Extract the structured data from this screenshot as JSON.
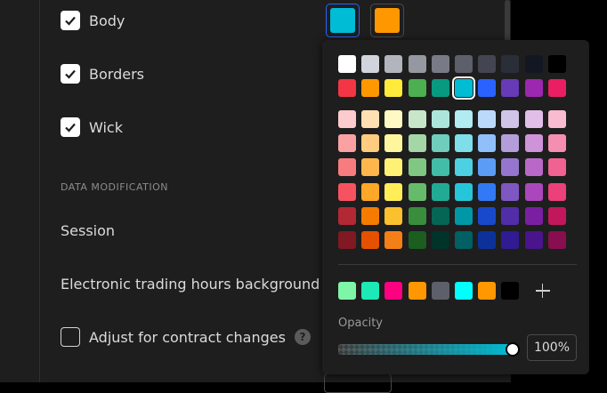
{
  "options": {
    "body": {
      "label": "Body",
      "checked": true
    },
    "borders": {
      "label": "Borders",
      "checked": true
    },
    "wick": {
      "label": "Wick",
      "checked": true
    }
  },
  "section_title": "DATA MODIFICATION",
  "session_label": "Session",
  "eth_label": "Electronic trading hours background",
  "adjust": {
    "label": "Adjust for contract changes",
    "checked": false,
    "help_icon": "?"
  },
  "body_colors": {
    "up": "#00bcd4",
    "down": "#ff9800"
  },
  "palette": {
    "main": [
      [
        "#ffffff",
        "#d1d4dc",
        "#b2b5be",
        "#9598a1",
        "#787b86",
        "#5d606b",
        "#434651",
        "#2a2e39",
        "#131722",
        "#000000"
      ],
      [
        "#f23645",
        "#ff9800",
        "#ffeb3b",
        "#4caf50",
        "#089981",
        "#00bcd4",
        "#2962ff",
        "#673ab7",
        "#9c27b0",
        "#e91e63"
      ]
    ],
    "shades": [
      [
        "#fccbcd",
        "#ffe0b2",
        "#fff9c4",
        "#c8e6c9",
        "#ace5dc",
        "#b2ebf2",
        "#bbd9fb",
        "#d1c4e9",
        "#e1bee7",
        "#f8bbd0"
      ],
      [
        "#faa1a4",
        "#ffcc80",
        "#fff59d",
        "#a5d6a7",
        "#70ccbd",
        "#80deea",
        "#90bff9",
        "#b39ddb",
        "#ce93d8",
        "#f48fb1"
      ],
      [
        "#f77c80",
        "#ffb74d",
        "#fff176",
        "#81c784",
        "#42bda8",
        "#4dd0e1",
        "#5b9cf6",
        "#9575cd",
        "#ba68c8",
        "#f06292"
      ],
      [
        "#f7525f",
        "#ffa726",
        "#ffee58",
        "#66bb6a",
        "#22ab94",
        "#26c6da",
        "#3179f5",
        "#7e57c2",
        "#ab47bc",
        "#ec407a"
      ],
      [
        "#b22833",
        "#f57c00",
        "#fbc02d",
        "#388e3c",
        "#056656",
        "#0097a7",
        "#1848cc",
        "#512da8",
        "#7b1fa2",
        "#c2185b"
      ],
      [
        "#801922",
        "#e65100",
        "#f57f17",
        "#1b5e20",
        "#00332a",
        "#006064",
        "#0c3299",
        "#311b92",
        "#4a148c",
        "#880e4f"
      ]
    ],
    "selected": "#00bcd4",
    "custom": [
      "#7ef5a7",
      "#1de9b6",
      "#ff0080",
      "#ff9800",
      "#5d606b",
      "#00ffff",
      "#ff9800",
      "#000000"
    ],
    "add_icon": "plus-icon"
  },
  "opacity": {
    "label": "Opacity",
    "value": "100%",
    "fraction": 1.0
  }
}
